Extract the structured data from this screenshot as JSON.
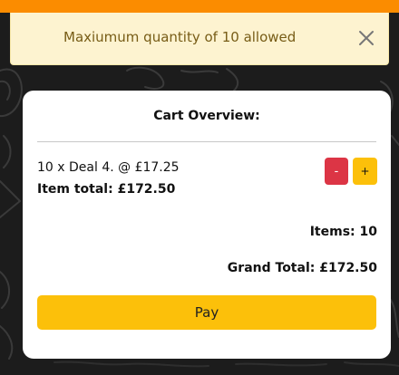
{
  "colors": {
    "top_bar": "#fb8c00",
    "alert_bg": "#fdf3d0",
    "alert_text": "#775c16",
    "minus_button": "#dc3545",
    "plus_button": "#fcc00a",
    "pay_button": "#fcc00a"
  },
  "alert": {
    "message": "Maxiumum quantity of 10 allowed",
    "close_icon": "close-x"
  },
  "cart": {
    "title": "Cart Overview:",
    "item": {
      "line": "10 x Deal 4. @ £17.25",
      "total": "Item total: £172.50",
      "decrease_label": "-",
      "increase_label": "+"
    },
    "items_count": "Items: 10",
    "grand_total": "Grand Total: £172.50",
    "pay_label": "Pay"
  }
}
